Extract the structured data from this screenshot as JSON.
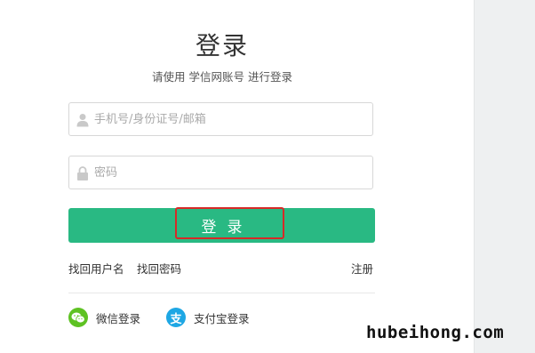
{
  "login": {
    "title": "登录",
    "subtitle": "请使用 学信网账号 进行登录",
    "username_placeholder": "手机号/身份证号/邮箱",
    "password_placeholder": "密码",
    "submit_label": "登录"
  },
  "links": {
    "find_username": "找回用户名",
    "find_password": "找回密码",
    "register": "注册"
  },
  "social": {
    "wechat_label": "微信登录",
    "alipay_label": "支付宝登录",
    "alipay_glyph": "支"
  },
  "icons": {
    "username": "user-icon",
    "password": "lock-icon",
    "wechat": "wechat-icon",
    "alipay": "alipay-icon"
  },
  "colors": {
    "primary_button": "#29b983",
    "highlight_box": "#d62a27",
    "wechat": "#5ec223",
    "alipay": "#1ea7e4"
  },
  "watermark": "hubeihong.com"
}
